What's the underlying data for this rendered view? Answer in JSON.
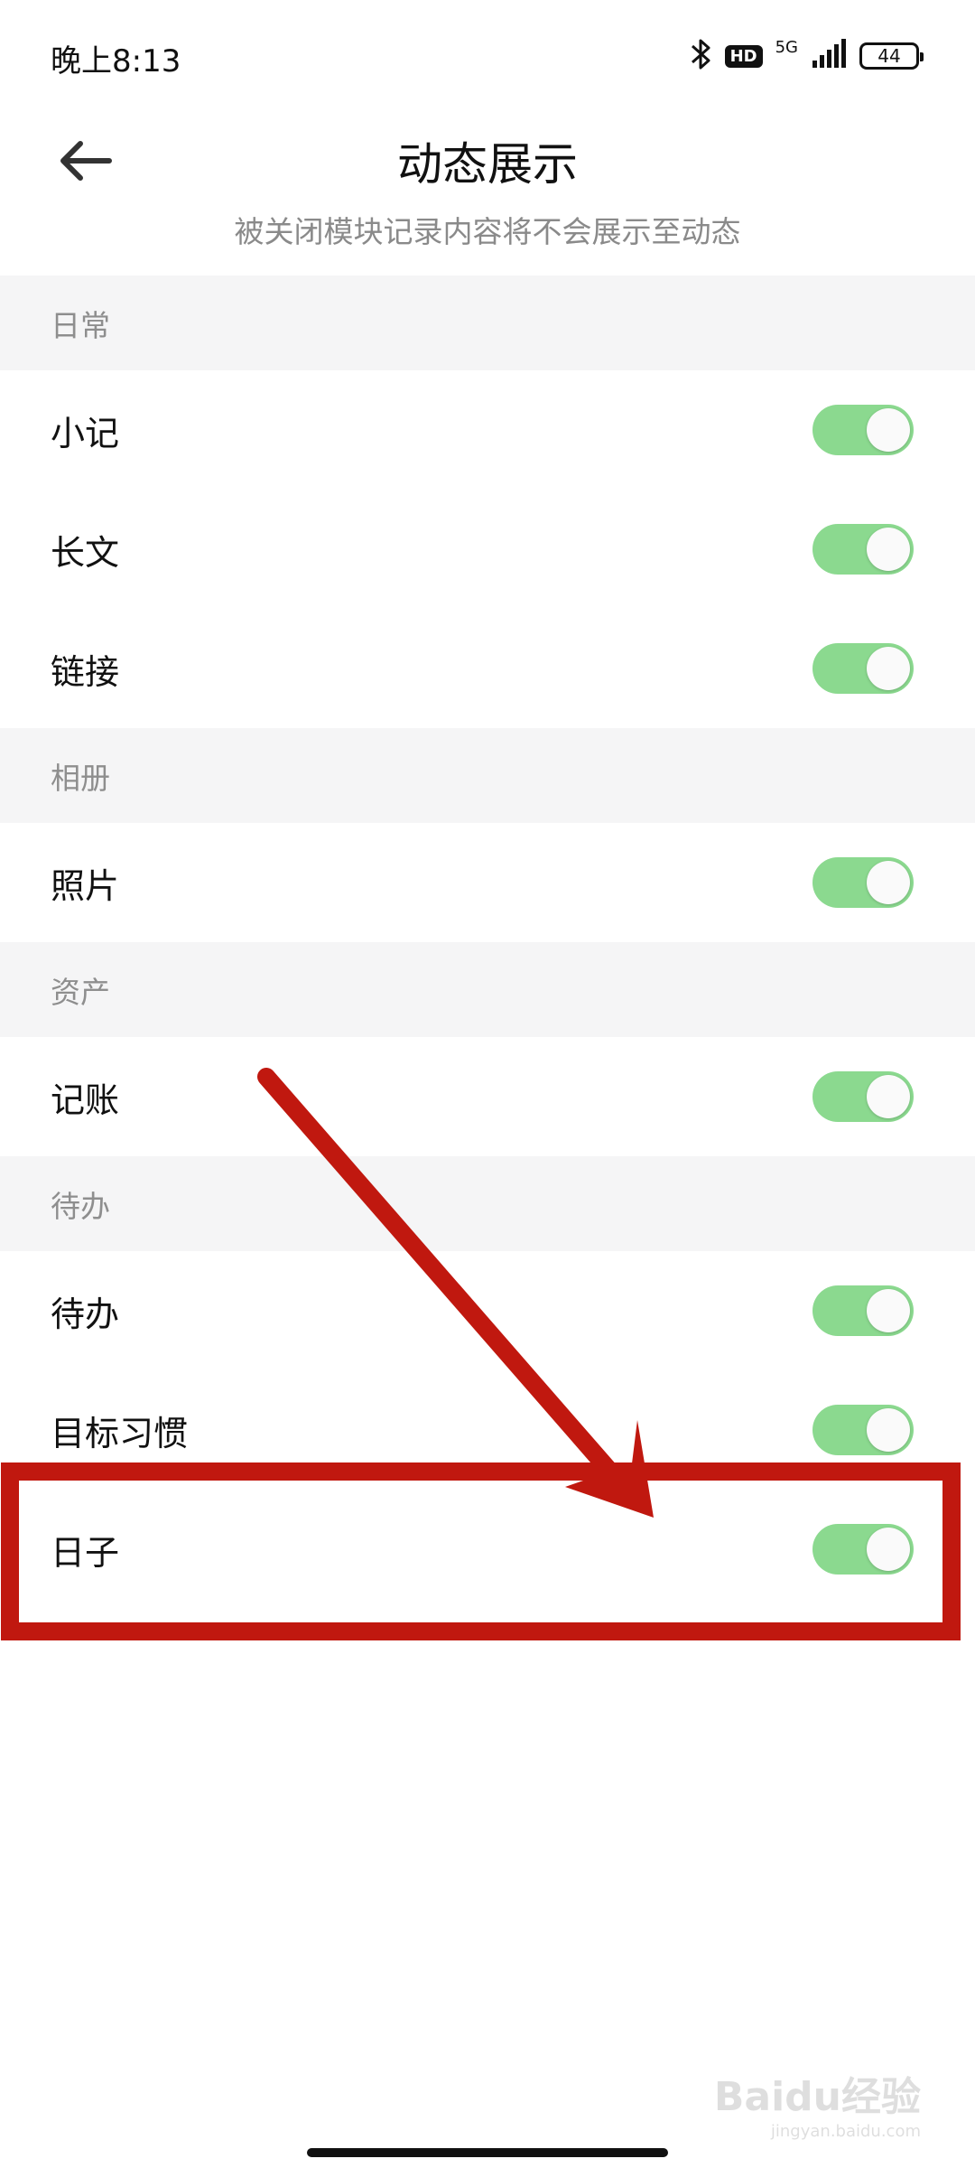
{
  "status_bar": {
    "time": "晚上8:13",
    "hd": "HD",
    "network": "5G",
    "battery": "44"
  },
  "header": {
    "title": "动态展示",
    "subtitle": "被关闭模块记录内容将不会展示至动态"
  },
  "sections": [
    {
      "header": "日常",
      "rows": [
        {
          "label": "小记",
          "on": true
        },
        {
          "label": "长文",
          "on": true
        },
        {
          "label": "链接",
          "on": true
        }
      ]
    },
    {
      "header": "相册",
      "rows": [
        {
          "label": "照片",
          "on": true
        }
      ]
    },
    {
      "header": "资产",
      "rows": [
        {
          "label": "记账",
          "on": true
        }
      ]
    },
    {
      "header": "待办",
      "rows": [
        {
          "label": "待办",
          "on": true
        },
        {
          "label": "目标习惯",
          "on": true
        },
        {
          "label": "日子",
          "on": true
        }
      ]
    }
  ],
  "colors": {
    "toggle_on": "#8bd98f",
    "annotation": "#c0180f"
  },
  "watermark": {
    "main": "Baidu经验",
    "sub": "jingyan.baidu.com"
  }
}
